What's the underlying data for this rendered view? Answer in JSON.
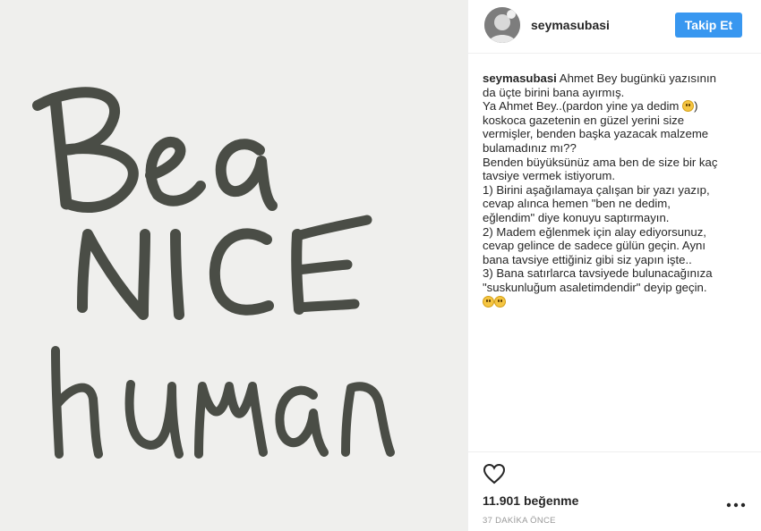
{
  "post": {
    "image": {
      "lettering": "Be a NICE human",
      "ink_color": "#4a4d46",
      "background_color": "#efefed"
    }
  },
  "header": {
    "username": "seymasubasi",
    "follow_label": "Takip Et",
    "follow_color": "#3897f0"
  },
  "caption": {
    "username": "seymasubasi",
    "lines": [
      "Ahmet Bey bugünkü yazısının",
      "da üçte birini bana ayırmış.",
      "Ya Ahmet Bey..(pardon yine ya dedim",
      ")",
      "koskoca gazetenin en güzel yerini size",
      "vermişler, benden başka yazacak malzeme",
      "bulamadınız mı??",
      "Benden büyüksünüz ama ben de size bir kaç",
      "tavsiye vermek istiyorum.",
      "1) Birini aşağılamaya çalışan bir yazı yazıp,",
      "cevap alınca hemen \"ben ne dedim,",
      "eğlendim\" diye konuyu saptırmayın.",
      "2) Madem eğlenmek için alay ediyorsunuz,",
      "cevap gelince de sadece gülün geçin. Aynı",
      "bana tavsiye ettiğiniz gibi siz yapın işte..",
      "3) Bana satırlarca tavsiyede bulunacağınıza",
      "\"suskunluğum asaletimdendir\" deyip geçin."
    ]
  },
  "actions": {
    "like_icon": "heart-outline-icon",
    "more_icon": "more-options-icon"
  },
  "likes": {
    "count_text": "11.901 beğenme"
  },
  "timestamp": "37 DAKİKA ÖNCE"
}
